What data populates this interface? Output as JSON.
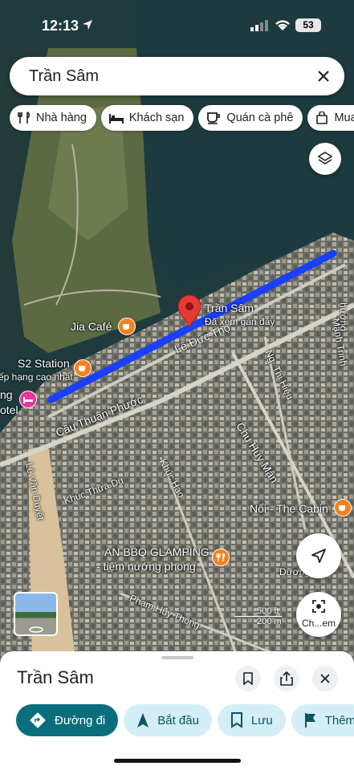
{
  "status_bar": {
    "time": "12:13",
    "battery": "53"
  },
  "search": {
    "query": "Trần Sâm"
  },
  "chips": [
    {
      "label": "Nhà hàng",
      "icon": "fork-knife-icon"
    },
    {
      "label": "Khách sạn",
      "icon": "bed-icon"
    },
    {
      "label": "Quán cà phê",
      "icon": "coffee-cup-icon"
    },
    {
      "label": "Mua",
      "icon": "shopping-bag-icon"
    }
  ],
  "map": {
    "pin": {
      "title": "Trần Sâm",
      "subtitle": "Đã xem gần đây"
    },
    "street_labels": {
      "le_duc_tho": "Lê Đức Thọ",
      "cau_thuan_phuoc": "Cầu Thuận Phước",
      "ng_thi_hieu": "Ng. Thị Hiệu",
      "chu_huy_man": "Chu Huy Mân",
      "khuc_hao": "Khúc Hạo",
      "khuc_thua_du": "Khúc Thừa Dụ",
      "le_van_duyet": "Lê Văn Duyệt",
      "pham_huy_thong": "Phạm Huy Thông",
      "ducong": "Dương",
      "huong": "hương",
      "manh_trinh": "Mạnh Trinh"
    },
    "places": {
      "jia_cafe": "Jia Café",
      "s2_station": "S2 Station",
      "xep_hang": "ếp hạng cao nhất",
      "ng_otel_1": "ng",
      "ng_otel_2": "otel",
      "noi_cabin": "Nổi - The Cabin",
      "an_bbq_1": "AN BBQ GLAMPING",
      "an_bbq_2": "- tiệm nướng phong..."
    },
    "scale": {
      "top": "500 ft",
      "bottom": "200 m"
    },
    "lens_label": "Ch...em"
  },
  "sheet": {
    "title": "Trần Sâm",
    "actions": [
      {
        "label": "Đường đi",
        "icon": "directions-icon"
      },
      {
        "label": "Bắt đầu",
        "icon": "navigation-arrow-icon"
      },
      {
        "label": "Lưu",
        "icon": "bookmark-icon"
      },
      {
        "label": "Thêm",
        "icon": "flag-icon"
      }
    ]
  },
  "colors": {
    "route": "#1a3fff",
    "pin": "#e53935",
    "primary_button": "#0b6e7d",
    "secondary_button": "#d3eef7"
  }
}
